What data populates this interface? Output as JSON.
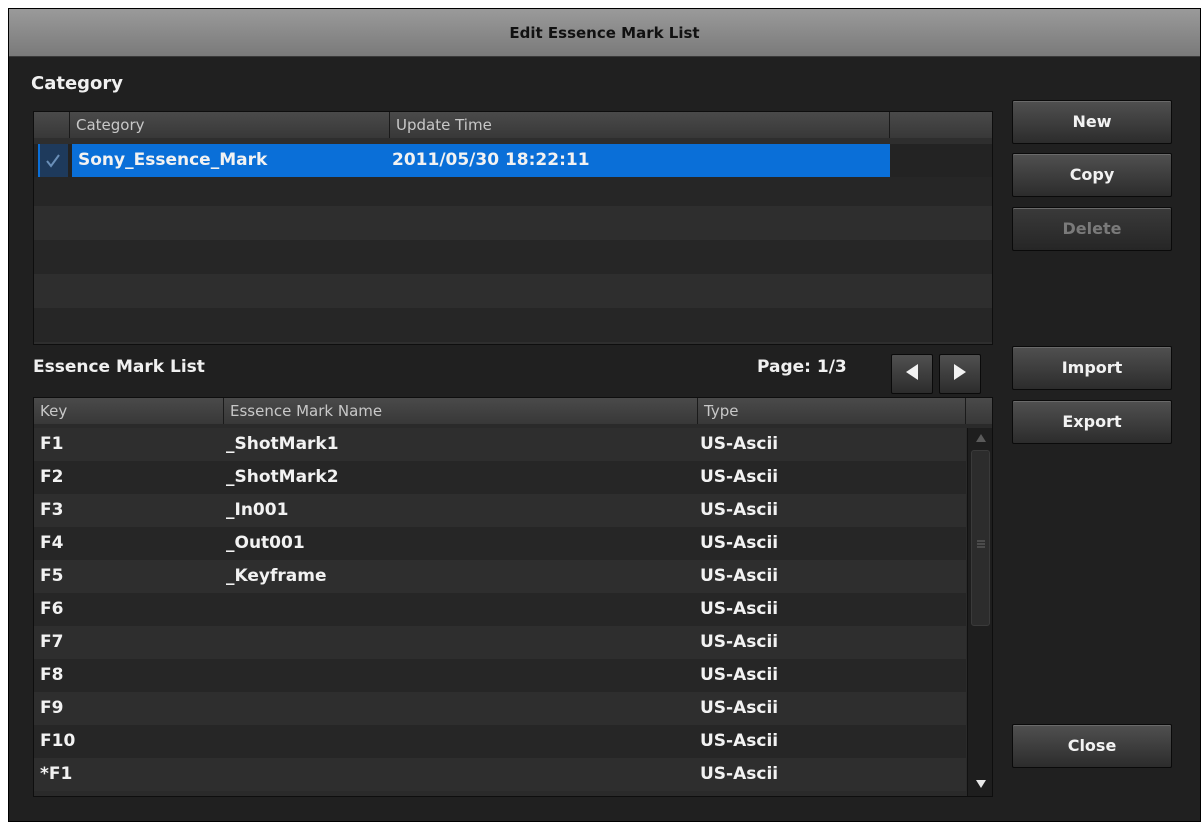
{
  "window": {
    "title": "Edit Essence Mark List"
  },
  "category_section": {
    "title": "Category",
    "columns": [
      "Category",
      "Update Time"
    ],
    "rows": [
      {
        "name": "Sony_Essence_Mark",
        "update_time": "2011/05/30 18:22:11",
        "selected": true
      }
    ]
  },
  "buttons": {
    "new": "New",
    "copy": "Copy",
    "delete": "Delete",
    "import": "Import",
    "export": "Export",
    "close": "Close"
  },
  "essence_section": {
    "title": "Essence Mark List",
    "page_label": "Page: 1/3",
    "columns": [
      "Key",
      "Essence Mark Name",
      "Type"
    ],
    "rows": [
      {
        "key": "F1",
        "name": "_ShotMark1",
        "type": "US-Ascii"
      },
      {
        "key": "F2",
        "name": "_ShotMark2",
        "type": "US-Ascii"
      },
      {
        "key": "F3",
        "name": "_In001",
        "type": "US-Ascii"
      },
      {
        "key": "F4",
        "name": "_Out001",
        "type": "US-Ascii"
      },
      {
        "key": "F5",
        "name": "_Keyframe",
        "type": "US-Ascii"
      },
      {
        "key": "F6",
        "name": "",
        "type": "US-Ascii"
      },
      {
        "key": "F7",
        "name": "",
        "type": "US-Ascii"
      },
      {
        "key": "F8",
        "name": "",
        "type": "US-Ascii"
      },
      {
        "key": "F9",
        "name": "",
        "type": "US-Ascii"
      },
      {
        "key": "F10",
        "name": "",
        "type": "US-Ascii"
      },
      {
        "key": "*F1",
        "name": "",
        "type": "US-Ascii"
      }
    ]
  },
  "colors": {
    "selection": "#0a6fd8",
    "background": "#202020",
    "title_bar": "#8a8a8a"
  },
  "icons": [
    "checkmark-icon",
    "prev-page-icon",
    "next-page-icon",
    "scroll-up-icon",
    "scroll-down-icon",
    "scroll-grip-icon"
  ]
}
